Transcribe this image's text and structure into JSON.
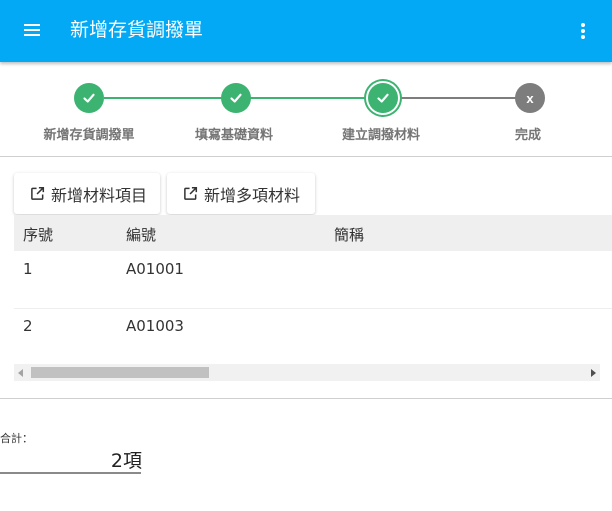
{
  "appbar": {
    "title": "新增存貨調撥單",
    "menu_icon": "menu-icon",
    "more_icon": "more-vert-icon",
    "color": "#03a9f4"
  },
  "stepper": {
    "steps": [
      {
        "label": "新增存貨調撥單",
        "status": "done",
        "icon": "check-icon"
      },
      {
        "label": "填寫基礎資料",
        "status": "done",
        "icon": "check-icon"
      },
      {
        "label": "建立調撥材料",
        "status": "active",
        "icon": "check-icon"
      },
      {
        "label": "完成",
        "status": "todo",
        "icon_text": "x"
      }
    ],
    "done_color": "#3cb371",
    "todo_color": "#7d7d7d"
  },
  "actions": {
    "add_item": {
      "label": "新增材料項目",
      "icon": "open-in-new-icon"
    },
    "add_multi": {
      "label": "新增多項材料",
      "icon": "open-in-new-icon"
    }
  },
  "table": {
    "columns": [
      "序號",
      "編號",
      "簡稱"
    ],
    "rows": [
      [
        "1",
        "A01001",
        ""
      ],
      [
        "2",
        "A01003",
        ""
      ]
    ]
  },
  "summary": {
    "label": "合計：",
    "value": "2項"
  }
}
